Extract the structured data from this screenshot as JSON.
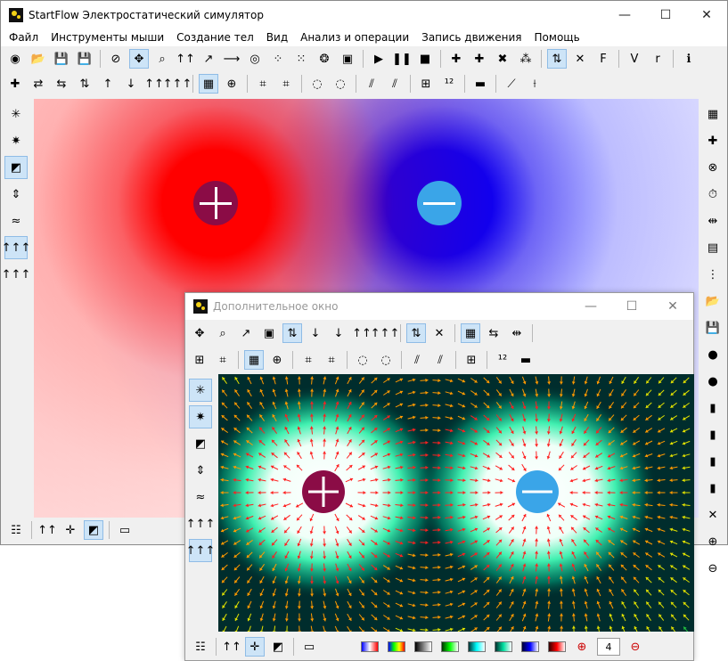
{
  "main_window": {
    "title": "StartFlow  Электростатический симулятор",
    "controls": {
      "minimize": "—",
      "maximize": "☐",
      "close": "✕"
    },
    "menu": [
      "Файл",
      "Инструменты мыши",
      "Создание тел",
      "Вид",
      "Анализ и операции",
      "Запись движения",
      "Помощь"
    ],
    "toolbar1_icons": [
      "new-icon",
      "open-icon",
      "save-icon",
      "save-as-icon",
      "pointer-icon",
      "move-icon",
      "zoom-icon",
      "field-lines-icon",
      "measure-icon",
      "probe-icon",
      "target-icon",
      "grid-dots-icon",
      "ring-dots-icon",
      "ring-icon",
      "image-icon",
      "play-icon",
      "pause-icon",
      "stop-icon",
      "add-positive-icon",
      "add-charge-icon",
      "delete-charge-icon",
      "scatter-icon",
      "vectors-icon",
      "cross-icon",
      "force-icon",
      "velocity-icon",
      "radius-icon",
      "info-icon"
    ],
    "toolbar1_glyphs": [
      "◉",
      "📂",
      "💾",
      "💾",
      "⊘",
      "✥",
      "⌕",
      "↑↑",
      "↗",
      "⟶",
      "◎",
      "⁘",
      "⁙",
      "❂",
      "▣",
      "▶",
      "❚❚",
      "■",
      "✚",
      "✚",
      "✖",
      "⁂",
      "⇅",
      "✕",
      "F",
      "V",
      "r",
      "ℹ"
    ],
    "toolbar2_glyphs": [
      "✚",
      "⇄",
      "⇆",
      "⇅",
      "↑",
      "↓",
      "↑↑",
      "↑↑↑",
      "▦",
      "⊕",
      "⌗",
      "⌗",
      "◌",
      "◌",
      "⫽",
      "⫽",
      "⊞",
      "¹²",
      "▬",
      "⟋",
      "⟊"
    ],
    "left_glyphs": [
      "✳",
      "✷",
      "◩",
      "⇕",
      "≈",
      "↑↑↑",
      "↑↑↑"
    ],
    "right_glyphs": [
      "▦",
      "✚",
      "⊗",
      "⏱",
      "⇹",
      "▤",
      "⋮",
      "📂",
      "💾",
      "●",
      "●",
      "▮",
      "▮",
      "▮",
      "▮",
      "✕",
      "⊕",
      "⊖"
    ],
    "bottom_glyphs": [
      "☷",
      "↑↑",
      "✛",
      "◩",
      "▭"
    ],
    "charges": [
      {
        "sign": "positive"
      },
      {
        "sign": "negative"
      }
    ]
  },
  "secondary_window": {
    "title": "Дополнительное окно",
    "controls": {
      "minimize": "—",
      "maximize": "☐",
      "close": "✕"
    },
    "toolbar1_glyphs": [
      "✥",
      "⌕",
      "↗",
      "▣",
      "⇅",
      "↓",
      "↓",
      "↑↑",
      "↑↑↑",
      "⇅",
      "✕",
      "▦",
      "⇆",
      "⇹"
    ],
    "toolbar2_glyphs": [
      "⊞",
      "⌗",
      "▦",
      "⊕",
      "⌗",
      "⌗",
      "◌",
      "◌",
      "⫽",
      "⫽",
      "⊞",
      "¹²",
      "▬"
    ],
    "left_glyphs": [
      "✳",
      "✷",
      "◩",
      "⇕",
      "≈",
      "↑↑↑",
      "↑↑↑"
    ],
    "bottom_glyphs": [
      "☷",
      "↑↑",
      "✛",
      "◩",
      "▭"
    ],
    "colormaps": [
      {
        "name": "blue-red",
        "colors": [
          "#0000ff",
          "#ffffff",
          "#ff0000"
        ]
      },
      {
        "name": "rainbow",
        "colors": [
          "#0000ff",
          "#00ff00",
          "#ffff00",
          "#ff0000"
        ]
      },
      {
        "name": "gray",
        "colors": [
          "#000000",
          "#ffffff"
        ]
      },
      {
        "name": "green",
        "colors": [
          "#003300",
          "#00ff00",
          "#ffffff"
        ]
      },
      {
        "name": "cyan",
        "colors": [
          "#003333",
          "#00ffff",
          "#ffffff"
        ]
      },
      {
        "name": "teal",
        "colors": [
          "#002d2d",
          "#00e0a0",
          "#ffffff"
        ]
      },
      {
        "name": "navy",
        "colors": [
          "#000033",
          "#0000ff",
          "#ffffff"
        ]
      },
      {
        "name": "dark-red",
        "colors": [
          "#330000",
          "#ff0000",
          "#ffffff"
        ]
      }
    ],
    "count_value": "4",
    "charges": [
      {
        "sign": "positive"
      },
      {
        "sign": "negative"
      }
    ]
  },
  "colors": {
    "positive": "#8b0c46",
    "negative": "#3aa5e8",
    "active_tool": "#cde4f7"
  }
}
